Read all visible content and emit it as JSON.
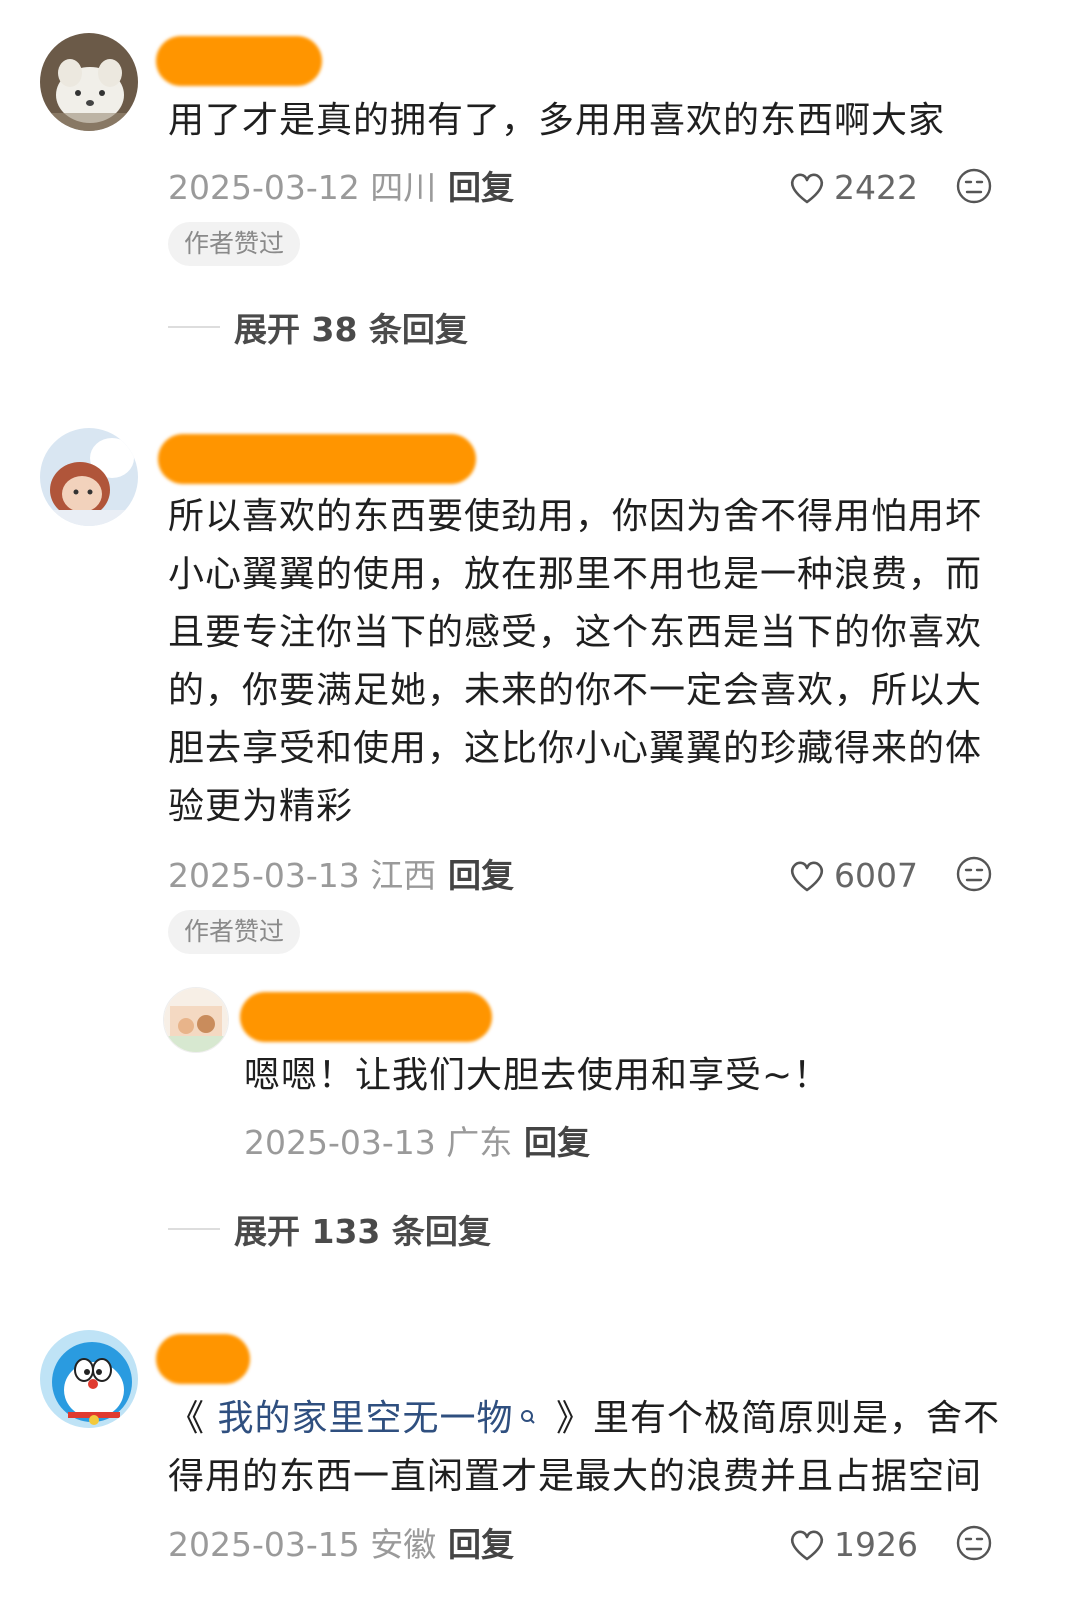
{
  "comments": [
    {
      "text": "用了才是真的拥有了，多用用喜欢的东西啊大家",
      "date": "2025-03-12 四川",
      "reply_label": "回复",
      "likes": "2422",
      "badge": "作者赞过",
      "expand_label": "展开 38 条回复"
    },
    {
      "text": "所以喜欢的东西要使劲用，你因为舍不得用怕用坏小心翼翼的使用，放在那里不用也是一种浪费，而且要专注你当下的感受，这个东西是当下的你喜欢的，你要满足她，未来的你不一定会喜欢，所以大胆去享受和使用，这比你小心翼翼的珍藏得来的体验更为精彩",
      "date": "2025-03-13 江西",
      "reply_label": "回复",
      "likes": "6007",
      "badge": "作者赞过",
      "sub_reply": {
        "text": "嗯嗯！让我们大胆去使用和享受~！",
        "date": "2025-03-13 广东",
        "reply_label": "回复"
      },
      "expand_label": "展开 133 条回复"
    },
    {
      "text_prefix": "《",
      "book_title": "我的家里空无一物",
      "text_suffix": "》里有个极简原则是，舍不得用的东西一直闲置才是最大的浪费并且占据空间",
      "date": "2025-03-15 安徽",
      "reply_label": "回复",
      "likes": "1926"
    }
  ],
  "icons": {
    "like": "heart-outline-icon",
    "dislike": "meh-face-icon",
    "search_hint": "search-icon"
  },
  "colors": {
    "redaction": "#ff9500",
    "link": "#2f4f7f",
    "meta_gray": "#9a9a9a"
  }
}
